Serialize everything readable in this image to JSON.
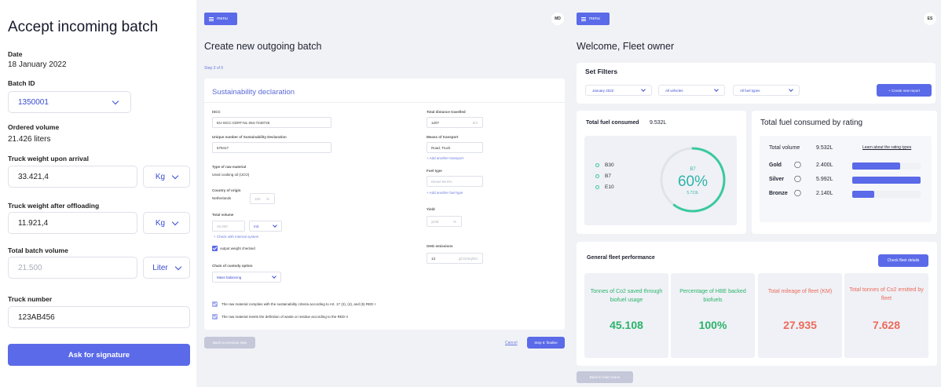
{
  "panel1": {
    "title": "Accept incoming batch",
    "date_label": "Date",
    "date_value": "18 January 2022",
    "batch_id_label": "Batch ID",
    "batch_id_value": "1350001",
    "ordered_volume_label": "Ordered volume",
    "ordered_volume_value": "21.426 liters",
    "truck_weight_arrival_label": "Truck weight upon arrival",
    "truck_weight_arrival_value": "33.421,4",
    "truck_weight_arrival_unit": "Kg",
    "truck_weight_after_label": "Truck weight after offloading",
    "truck_weight_after_value": "11.921,4",
    "truck_weight_after_unit": "Kg",
    "total_batch_volume_label": "Total batch volume",
    "total_batch_volume_placeholder": "21.500",
    "total_batch_volume_unit": "Liter",
    "truck_number_label": "Truck number",
    "truck_number_value": "123AB456",
    "signature_button": "Ask for signature"
  },
  "panel2": {
    "menu_label": "menu",
    "avatar": "MD",
    "title": "Create new outgoing batch",
    "step": "Step 3 of 5",
    "card_title": "Sustainability declaration",
    "iscc_label": "ISCC",
    "iscc_value": "EU-ISCC-CERT-NL-264-7249725",
    "pos_number_label": "Unique number of Sustainability Declaration",
    "pos_number_value": "579417",
    "raw_material_label": "Type of raw material",
    "raw_material_value": "Used cooking oil (UCO)",
    "country_label": "Country of origin",
    "country_value": "Netherlands",
    "country_percent": "100",
    "percent_sign": "%",
    "total_volume_label": "Total volume",
    "total_volume_value": "45.000",
    "total_volume_unit": "m3",
    "check_internal_link": "+ Check with internal system",
    "output_weight_checkbox": "output weight checked",
    "chain_custody_label": "Chain of custody option",
    "chain_custody_value": "Mass balancing",
    "distance_label": "Total distance travelled",
    "distance_value": "1207",
    "distance_unit": "km",
    "transport_label": "Means of transport",
    "transport_value": "Road, Truck",
    "add_transport_link": "+ Add another transport",
    "fuel_type_label": "Fuel type",
    "fuel_type_placeholder": "Diesel 99.5%",
    "add_fuel_link": "+ Add another fuel type",
    "yield_label": "Yield",
    "yield_placeholder": "yield",
    "ghg_label": "GHG emissions",
    "ghg_value": "13",
    "ghg_unit": "gCO2eq/MJ",
    "declaration_1": "The raw material complies with the sustainability criteria according to Art. 17 (2), (4), and (5) RED I",
    "declaration_2": "The raw material meets the definition of waste or residue according to the RED II",
    "back_button": "Back to previous step",
    "cancel_link": "Cancel",
    "next_button": "Step 5: finalise"
  },
  "panel3": {
    "menu_label": "menu",
    "avatar": "ES",
    "title": "Welcome, Fleet owner",
    "filters_title": "Set Filters",
    "filter_month": "January 2022",
    "filter_vehicles": "All vehicles",
    "filter_fuel": "All fuel types",
    "create_report_button": "+ Create new report",
    "total_fuel_label": "Total fuel consumed",
    "total_fuel_value": "9.532L",
    "legend": [
      "B30",
      "B7",
      "E10"
    ],
    "gauge_series": "B7",
    "gauge_percent": "60%",
    "gauge_amount": "5.719L",
    "gauge_fraction": 0.6,
    "rating_title": "Total fuel consumed by rating",
    "rating_total_label": "Total volume",
    "rating_total_value": "9.532L",
    "rating_link": "Learn about the rating types",
    "ratings": [
      {
        "name": "Gold",
        "value": "2.400L",
        "fraction": 0.7
      },
      {
        "name": "Silver",
        "value": "5.992L",
        "fraction": 1.0
      },
      {
        "name": "Bronze",
        "value": "2.140L",
        "fraction": 0.32
      }
    ],
    "performance_title": "General fleet performance",
    "fleet_details_button": "Check fleet details",
    "kpis": [
      {
        "title": "Tonnes of Co2 saved through biofuel usage",
        "value": "45.108",
        "color": "#2bb36a"
      },
      {
        "title": "Percentage of HBE backed biofuels",
        "value": "100%",
        "color": "#2bb36a"
      },
      {
        "title": "Total mileage of fleet (KM)",
        "value": "27.935",
        "color": "#ee6a5a"
      },
      {
        "title": "Total tonnes of Co2 emitted by fleet",
        "value": "7.628",
        "color": "#ee6a5a"
      }
    ],
    "back_main_button": "Back to main menu"
  }
}
